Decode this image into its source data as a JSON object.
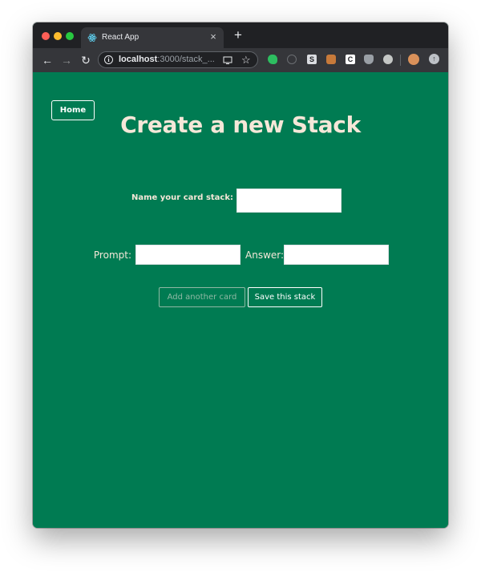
{
  "browser": {
    "tab_title": "React App",
    "new_tab": "+",
    "close_tab": "×",
    "url_host": "localhost",
    "url_rest": ":3000/stack_...",
    "info_glyph": "i",
    "star_glyph": "☆",
    "back_glyph": "←",
    "forward_glyph": "→",
    "reload_glyph": "↻",
    "extensions": {
      "s_label": "S",
      "c_label": "C",
      "update_glyph": "↑"
    },
    "colors": {
      "tabbar": "#202124",
      "toolbar": "#35363a",
      "traffic_red": "#ff5f57",
      "traffic_yellow": "#febc2e",
      "traffic_green": "#28c840"
    }
  },
  "page": {
    "home_label": "Home",
    "title": "Create a new Stack",
    "stack_name_label": "Name your card stack:",
    "stack_name_value": "",
    "prompt_label": "Prompt:",
    "prompt_value": "",
    "answer_label": "Answer:",
    "answer_value": "",
    "add_card_label": "Add another card",
    "save_stack_label": "Save this stack",
    "colors": {
      "background": "#007b52",
      "title_text": "#f5e7d8",
      "input_background": "#ffffff"
    }
  }
}
